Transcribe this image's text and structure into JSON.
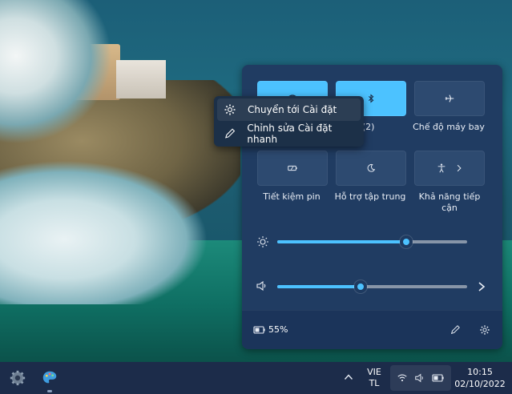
{
  "quick_settings": {
    "tiles": [
      {
        "id": "wifi",
        "label": "",
        "active": true,
        "icon": "wifi-icon"
      },
      {
        "id": "bluetooth",
        "label": "ết nối (2)",
        "active": true,
        "icon": "bluetooth-icon"
      },
      {
        "id": "airplane",
        "label": "Chế độ máy bay",
        "active": false,
        "icon": "airplane-icon"
      },
      {
        "id": "battery_saver",
        "label": "Tiết kiệm pin",
        "active": false,
        "icon": "battery-saver-icon"
      },
      {
        "id": "focus",
        "label": "Hỗ trợ tập trung",
        "active": false,
        "icon": "moon-icon"
      },
      {
        "id": "accessibility",
        "label": "Khả năng tiếp cận",
        "active": false,
        "icon": "accessibility-icon"
      }
    ],
    "brightness_level": 0.68,
    "volume_level": 0.44,
    "battery_text": "55%"
  },
  "context_menu": {
    "items": [
      {
        "label": "Chuyển tới Cài đặt",
        "icon": "gear-icon"
      },
      {
        "label": "Chỉnh sửa Cài đặt nhanh",
        "icon": "pencil-icon"
      }
    ]
  },
  "taskbar": {
    "lang_line1": "VIE",
    "lang_line2": "TL",
    "time": "10:15",
    "date": "02/10/2022"
  },
  "colors": {
    "accent": "#4cc2ff",
    "panel": "#203c62",
    "taskbar": "#1c2c4a"
  }
}
